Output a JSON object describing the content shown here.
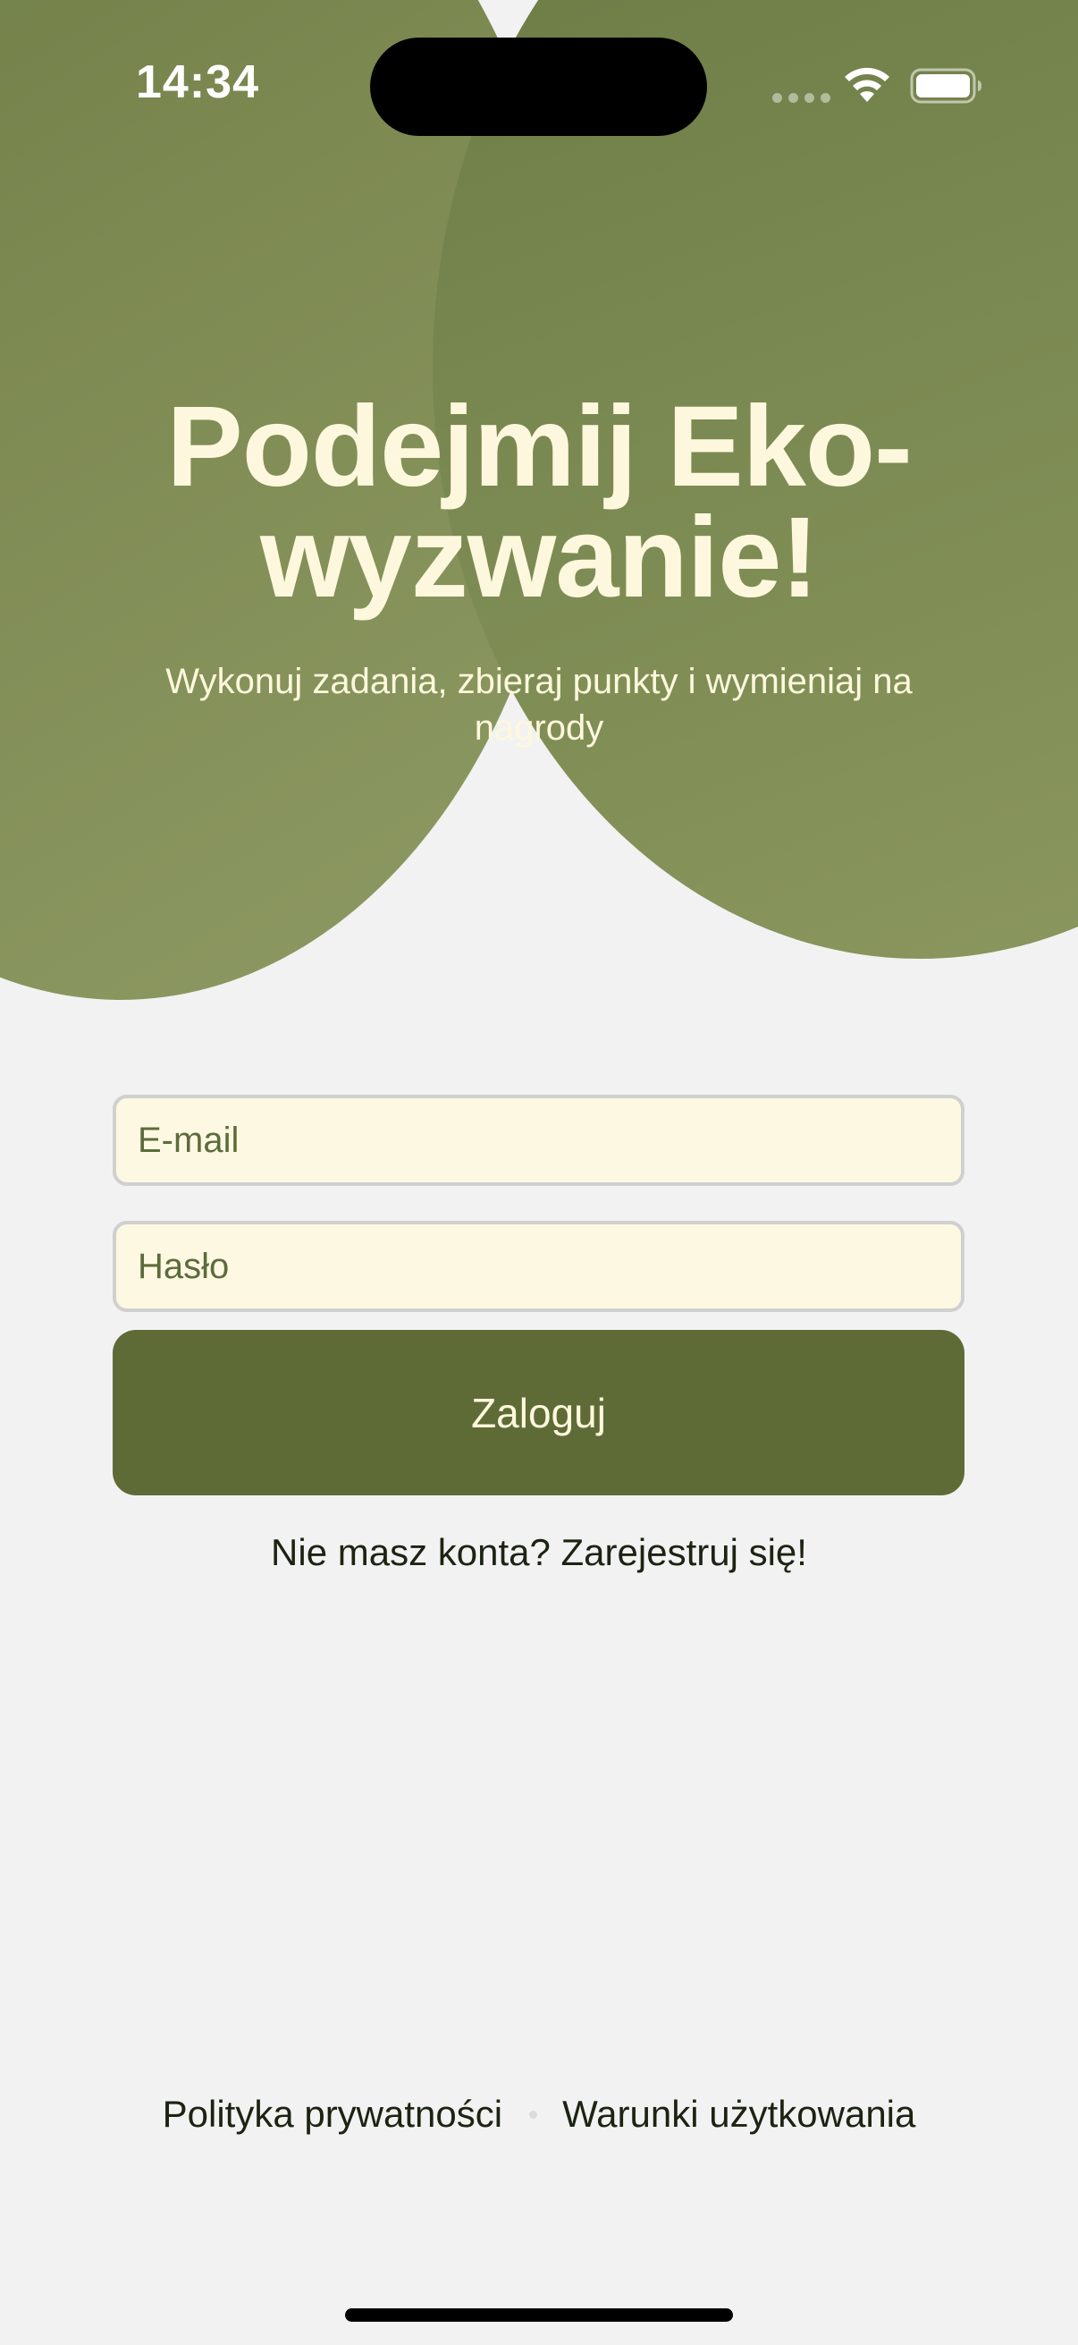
{
  "status_bar": {
    "time": "14:34"
  },
  "hero": {
    "title_line1": "Podejmij Eko-",
    "title_line2": "wyzwanie!",
    "subtitle": "Wykonuj zadania, zbieraj punkty i wymieniaj na nagrody"
  },
  "form": {
    "email_placeholder": "E-mail",
    "email_value": "",
    "password_placeholder": "Hasło",
    "password_value": "",
    "login_label": "Zaloguj",
    "register_text": "Nie masz konta? Zarejestruj się!"
  },
  "footer": {
    "privacy": "Polityka prywatności",
    "terms": "Warunki użytkowania"
  },
  "colors": {
    "background": "#f2f2f2",
    "brand_green": "#5f6b37",
    "hero_text": "#fdf8dd",
    "field_fill": "#fdf8e2"
  },
  "icons": {
    "wifi": "wifi-icon",
    "battery": "battery-icon",
    "signal": "cellular-signal-icon"
  }
}
